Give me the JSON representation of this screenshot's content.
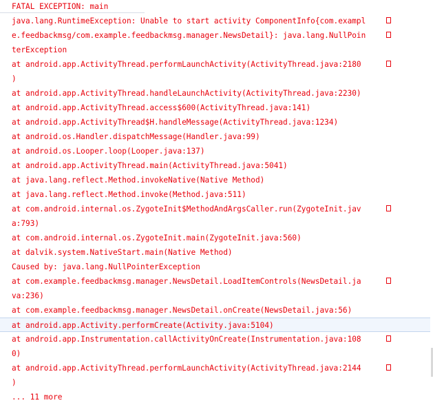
{
  "log": {
    "header": "FATAL EXCEPTION: main",
    "lines": [
      {
        "text": "java.lang.RuntimeException: Unable to start activity ComponentInfo{com.exampl",
        "wrap": true
      },
      {
        "text": "e.feedbackmsg/com.example.feedbackmsg.manager.NewsDetail}: java.lang.NullPoin",
        "wrap": true
      },
      {
        "text": "terException",
        "wrap": false
      },
      {
        "text": "at android.app.ActivityThread.performLaunchActivity(ActivityThread.java:2180",
        "wrap": true
      },
      {
        "text": ")",
        "wrap": false
      },
      {
        "text": "at android.app.ActivityThread.handleLaunchActivity(ActivityThread.java:2230)",
        "wrap": false
      },
      {
        "text": "at android.app.ActivityThread.access$600(ActivityThread.java:141)",
        "wrap": false
      },
      {
        "text": "at android.app.ActivityThread$H.handleMessage(ActivityThread.java:1234)",
        "wrap": false
      },
      {
        "text": "at android.os.Handler.dispatchMessage(Handler.java:99)",
        "wrap": false
      },
      {
        "text": "at android.os.Looper.loop(Looper.java:137)",
        "wrap": false
      },
      {
        "text": "at android.app.ActivityThread.main(ActivityThread.java:5041)",
        "wrap": false
      },
      {
        "text": "at java.lang.reflect.Method.invokeNative(Native Method)",
        "wrap": false
      },
      {
        "text": "at java.lang.reflect.Method.invoke(Method.java:511)",
        "wrap": false
      },
      {
        "text": "at com.android.internal.os.ZygoteInit$MethodAndArgsCaller.run(ZygoteInit.jav",
        "wrap": true
      },
      {
        "text": "a:793)",
        "wrap": false
      },
      {
        "text": "at com.android.internal.os.ZygoteInit.main(ZygoteInit.java:560)",
        "wrap": false
      },
      {
        "text": "at dalvik.system.NativeStart.main(Native Method)",
        "wrap": false
      },
      {
        "text": "Caused by: java.lang.NullPointerException",
        "wrap": false
      },
      {
        "text": "at com.example.feedbackmsg.manager.NewsDetail.LoadItemControls(NewsDetail.ja",
        "wrap": true
      },
      {
        "text": "va:236)",
        "wrap": false
      },
      {
        "text": "at com.example.feedbackmsg.manager.NewsDetail.onCreate(NewsDetail.java:56)",
        "wrap": false
      },
      {
        "text": "at android.app.Activity.performCreate(Activity.java:5104)",
        "wrap": false,
        "selected": true
      },
      {
        "text": "at android.app.Instrumentation.callActivityOnCreate(Instrumentation.java:108",
        "wrap": true
      },
      {
        "text": "0)",
        "wrap": false
      },
      {
        "text": "at android.app.ActivityThread.performLaunchActivity(ActivityThread.java:2144",
        "wrap": true
      },
      {
        "text": ")",
        "wrap": false
      },
      {
        "text": "... 11 more",
        "wrap": false
      }
    ]
  },
  "colors": {
    "text": "#e8000b",
    "background": "#ffffff",
    "selection": "#f1f6fd"
  }
}
